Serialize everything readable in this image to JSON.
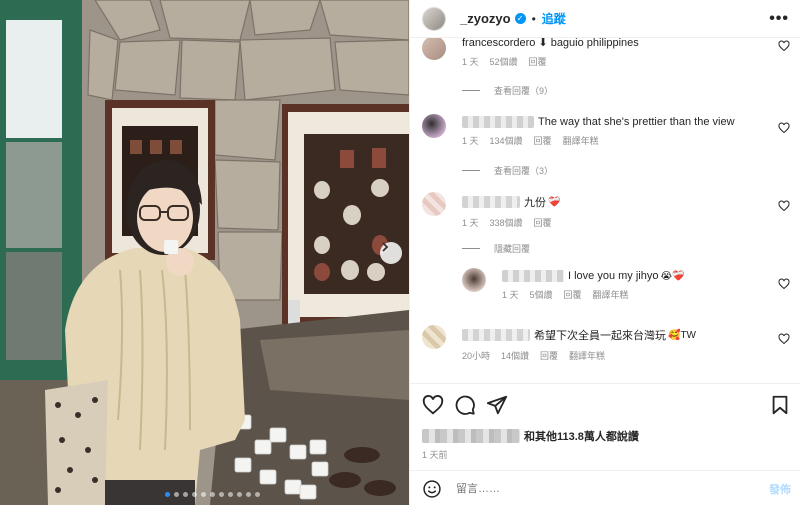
{
  "post": {
    "username": "_zyozyo",
    "follow_label": "追蹤",
    "dot": "•",
    "more_label": "•••"
  },
  "comments": [
    {
      "text": "francescordero ⬇ baguio philippines",
      "time": "1 天",
      "likes": "52個讚",
      "reply": "回覆",
      "translate": ""
    },
    {
      "view_replies": "查看回覆（9）"
    },
    {
      "text": "The way that she's prettier than the view",
      "time": "1 天",
      "likes": "134個讚",
      "reply": "回覆",
      "translate": "翻譯年糕"
    },
    {
      "view_replies": "查看回覆（3）"
    },
    {
      "text": "九份",
      "emoji": "❤️‍🩹",
      "time": "1 天",
      "likes": "338個讚",
      "reply": "回覆",
      "translate": ""
    },
    {
      "view_replies": "隱藏回覆"
    },
    {
      "text": "I love you my jihyo",
      "emoji": "😭❤️‍🩹",
      "time": "1 天",
      "likes": "5個讚",
      "reply": "回覆",
      "translate": "翻譯年糕"
    },
    {
      "text": "希望下次全員一起來台灣玩",
      "emoji": "🥰TW",
      "time": "20小時",
      "likes": "14個讚",
      "reply": "回覆",
      "translate": "翻譯年糕"
    }
  ],
  "actions": {
    "likes_text": "和其他113.8萬人都說讚",
    "date": "1 天前",
    "comment_placeholder": "留言……",
    "post_label": "發佈"
  },
  "carousel": {
    "total": 11,
    "active": 1
  },
  "colors": {
    "accent": "#0095f6",
    "text": "#262626",
    "secondary": "#8e8e8e"
  }
}
